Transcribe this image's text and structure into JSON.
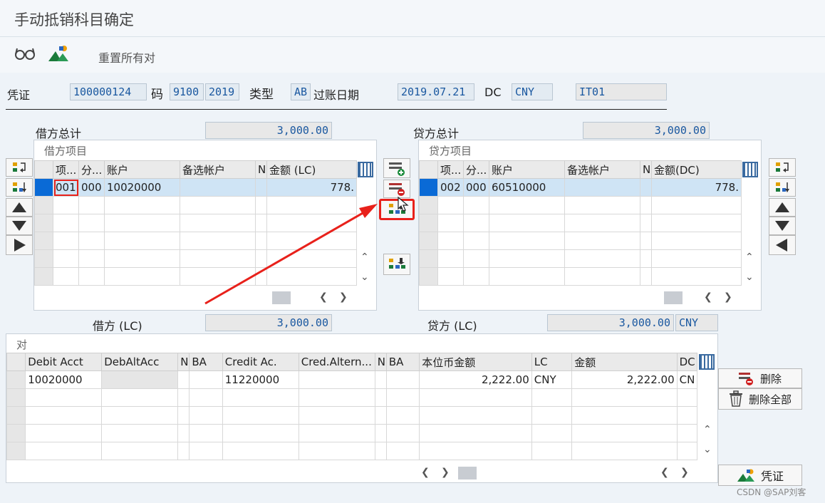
{
  "window": {
    "title": "手动抵销科目确定"
  },
  "toolbar": {
    "glasses_icon": "glasses-icon",
    "mountain_icon": "mountain-icon",
    "reset_label": "重置所有对"
  },
  "header": {
    "voucher_label": "凭证",
    "voucher_no": "100000124",
    "code_label": "码",
    "company_code": "9100",
    "year": "2019",
    "type_label": "类型",
    "doc_type": "AB",
    "posting_label": "过账日期",
    "posting_date": "2019.07.21",
    "dc_label": "DC",
    "currency": "CNY",
    "item_field": "IT01"
  },
  "debit": {
    "total_label": "借方总计",
    "total": "3,000.00",
    "panel_title": "借方项目",
    "columns": [
      "项...",
      "分...",
      "账户",
      "备选帐户",
      "N",
      "金额 (LC)"
    ],
    "rows": [
      {
        "item": "001",
        "sub": "000",
        "account": "10020000",
        "alt": "",
        "amount": "778."
      }
    ],
    "lc_label": "借方 (LC)",
    "lc_total": "3,000.00"
  },
  "credit": {
    "total_label": "贷方总计",
    "total": "3,000.00",
    "panel_title": "贷方项目",
    "columns": [
      "项...",
      "分...",
      "账户",
      "备选帐户",
      "N",
      "金额(DC)"
    ],
    "rows": [
      {
        "item": "002",
        "sub": "000",
        "account": "60510000",
        "alt": "",
        "amount": "778."
      }
    ],
    "lc_label": "贷方 (LC)",
    "lc_total": "3,000.00",
    "lc_currency": "CNY"
  },
  "pairs": {
    "title": "对",
    "columns": [
      "Debit Acct",
      "DebAltAcc",
      "N",
      "BA",
      "Credit Ac.",
      "Cred.Altern...",
      "N",
      "BA",
      "本位币金额",
      "LC",
      "金额",
      "DC"
    ],
    "rows": [
      {
        "debit_acct": "10020000",
        "credit_acct": "11220000",
        "lc_amount": "2,222.00",
        "lc": "CNY",
        "amount": "2,222.00",
        "dc": "CN"
      }
    ],
    "delete_label": "删除",
    "delete_all_label": "删除全部",
    "voucher_button": "凭证"
  },
  "watermark": "CSDN @SAP刘客",
  "colors": {
    "highlight": "#e8211b",
    "selection": "#0a6ad6"
  }
}
